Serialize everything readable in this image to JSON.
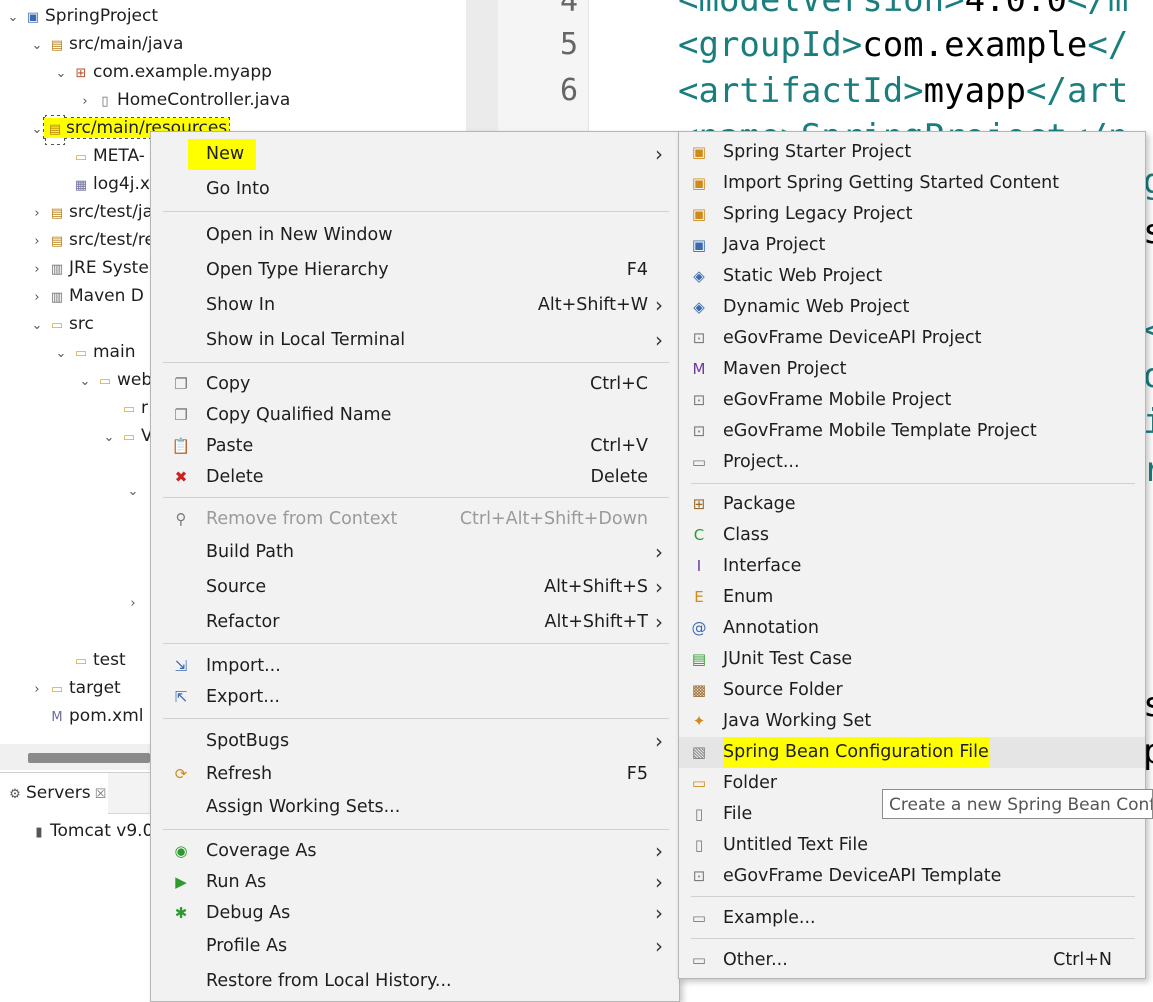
{
  "explorer": {
    "rows": [
      {
        "twisty": "⌄",
        "icon": "▣",
        "label": "SpringProject"
      },
      {
        "twisty": "⌄",
        "icon": "▤",
        "label": "src/main/java"
      },
      {
        "twisty": "⌄",
        "icon": "⊞",
        "label": "com.example.myapp"
      },
      {
        "twisty": "›",
        "icon": "▯",
        "label": "HomeController.java"
      },
      {
        "twisty": "⌄",
        "icon": "▤",
        "label": "src/main/resources"
      },
      {
        "twisty": "",
        "icon": "▭",
        "label": "META-"
      },
      {
        "twisty": "",
        "icon": "▦",
        "label": "log4j.x"
      },
      {
        "twisty": "›",
        "icon": "▤",
        "label": "src/test/ja"
      },
      {
        "twisty": "›",
        "icon": "▤",
        "label": "src/test/re"
      },
      {
        "twisty": "›",
        "icon": "▥",
        "label": "JRE Syste"
      },
      {
        "twisty": "›",
        "icon": "▥",
        "label": "Maven D"
      },
      {
        "twisty": "⌄",
        "icon": "▭",
        "label": "src"
      },
      {
        "twisty": "⌄",
        "icon": "▭",
        "label": "main"
      },
      {
        "twisty": "⌄",
        "icon": "▭",
        "label": "web"
      },
      {
        "twisty": "",
        "icon": "▭",
        "label": "r"
      },
      {
        "twisty": "⌄",
        "icon": "▭",
        "label": "V"
      },
      {
        "twisty": "",
        "icon": "▭",
        "label": "test"
      },
      {
        "twisty": "›",
        "icon": "▭",
        "label": "target"
      },
      {
        "twisty": "",
        "icon": "M",
        "label": "pom.xml"
      }
    ],
    "orphan_twisties": [
      "⌄",
      "›"
    ]
  },
  "servers": {
    "tab_label": "Servers",
    "tab_icon": "⚙",
    "tab_close": "☒",
    "item_icon": "▮",
    "item_label": "Tomcat v9.0"
  },
  "editor": {
    "lines": [
      {
        "num": "4",
        "open": "<modelVersion>",
        "text": "4.0.0",
        "close": "</m"
      },
      {
        "num": "5",
        "open": "<groupId>",
        "text": "com.example",
        "close": "</"
      },
      {
        "num": "6",
        "open": "<artifactId>",
        "text": "myapp",
        "close": "</art"
      }
    ],
    "line7_fragment": "<name>SpringProject</n",
    "right_edge_fragments": [
      "g",
      "s",
      "<",
      "o",
      "i",
      "r",
      "s",
      "p"
    ]
  },
  "context_menu": {
    "items": [
      {
        "icon": "",
        "label": "New",
        "shortcut": "",
        "submenu": true
      },
      {
        "icon": "",
        "label": "Go Into",
        "shortcut": "",
        "submenu": false
      },
      {
        "icon": "",
        "label": "Open in New Window",
        "shortcut": "",
        "submenu": false
      },
      {
        "icon": "",
        "label": "Open Type Hierarchy",
        "shortcut": "F4",
        "submenu": false
      },
      {
        "icon": "",
        "label": "Show In",
        "shortcut": "Alt+Shift+W",
        "submenu": true
      },
      {
        "icon": "",
        "label": "Show in Local Terminal",
        "shortcut": "",
        "submenu": true
      },
      {
        "icon": "❐",
        "label": "Copy",
        "shortcut": "Ctrl+C",
        "submenu": false
      },
      {
        "icon": "❐",
        "label": "Copy Qualified Name",
        "shortcut": "",
        "submenu": false
      },
      {
        "icon": "📋",
        "label": "Paste",
        "shortcut": "Ctrl+V",
        "submenu": false
      },
      {
        "icon": "✖",
        "label": "Delete",
        "shortcut": "Delete",
        "submenu": false
      },
      {
        "icon": "⚲",
        "label": "Remove from Context",
        "shortcut": "Ctrl+Alt+Shift+Down",
        "submenu": false
      },
      {
        "icon": "",
        "label": "Build Path",
        "shortcut": "",
        "submenu": true
      },
      {
        "icon": "",
        "label": "Source",
        "shortcut": "Alt+Shift+S",
        "submenu": true
      },
      {
        "icon": "",
        "label": "Refactor",
        "shortcut": "Alt+Shift+T",
        "submenu": true
      },
      {
        "icon": "⇲",
        "label": "Import...",
        "shortcut": "",
        "submenu": false
      },
      {
        "icon": "⇱",
        "label": "Export...",
        "shortcut": "",
        "submenu": false
      },
      {
        "icon": "",
        "label": "SpotBugs",
        "shortcut": "",
        "submenu": true
      },
      {
        "icon": "⟳",
        "label": "Refresh",
        "shortcut": "F5",
        "submenu": false
      },
      {
        "icon": "",
        "label": "Assign Working Sets...",
        "shortcut": "",
        "submenu": false
      },
      {
        "icon": "◉",
        "label": "Coverage As",
        "shortcut": "",
        "submenu": true
      },
      {
        "icon": "▶",
        "label": "Run As",
        "shortcut": "",
        "submenu": true
      },
      {
        "icon": "✱",
        "label": "Debug As",
        "shortcut": "",
        "submenu": true
      },
      {
        "icon": "",
        "label": "Profile As",
        "shortcut": "",
        "submenu": true
      },
      {
        "icon": "",
        "label": "Restore from Local History...",
        "shortcut": "",
        "submenu": false
      }
    ],
    "submenu_arrow": "›"
  },
  "new_submenu": {
    "items": [
      {
        "icon": "▣",
        "label": "Spring Starter Project",
        "shortcut": ""
      },
      {
        "icon": "▣",
        "label": "Import Spring Getting Started Content",
        "shortcut": ""
      },
      {
        "icon": "▣",
        "label": "Spring Legacy Project",
        "shortcut": ""
      },
      {
        "icon": "▣",
        "label": "Java Project",
        "shortcut": ""
      },
      {
        "icon": "◈",
        "label": "Static Web Project",
        "shortcut": ""
      },
      {
        "icon": "◈",
        "label": "Dynamic Web Project",
        "shortcut": ""
      },
      {
        "icon": "⊡",
        "label": "eGovFrame DeviceAPI Project",
        "shortcut": ""
      },
      {
        "icon": "M",
        "label": "Maven Project",
        "shortcut": ""
      },
      {
        "icon": "⊡",
        "label": "eGovFrame Mobile Project",
        "shortcut": ""
      },
      {
        "icon": "⊡",
        "label": "eGovFrame Mobile Template Project",
        "shortcut": ""
      },
      {
        "icon": "▭",
        "label": "Project...",
        "shortcut": ""
      },
      {
        "icon": "⊞",
        "label": "Package",
        "shortcut": ""
      },
      {
        "icon": "C",
        "label": "Class",
        "shortcut": ""
      },
      {
        "icon": "I",
        "label": "Interface",
        "shortcut": ""
      },
      {
        "icon": "E",
        "label": "Enum",
        "shortcut": ""
      },
      {
        "icon": "@",
        "label": "Annotation",
        "shortcut": ""
      },
      {
        "icon": "▤",
        "label": "JUnit Test Case",
        "shortcut": ""
      },
      {
        "icon": "▩",
        "label": "Source Folder",
        "shortcut": ""
      },
      {
        "icon": "✦",
        "label": "Java Working Set",
        "shortcut": ""
      },
      {
        "icon": "▧",
        "label": "Spring Bean Configuration File",
        "shortcut": ""
      },
      {
        "icon": "▭",
        "label": "Folder",
        "shortcut": ""
      },
      {
        "icon": "▯",
        "label": "File",
        "shortcut": ""
      },
      {
        "icon": "▯",
        "label": "Untitled Text File",
        "shortcut": ""
      },
      {
        "icon": "⊡",
        "label": "eGovFrame DeviceAPI Template",
        "shortcut": ""
      },
      {
        "icon": "▭",
        "label": "Example...",
        "shortcut": ""
      },
      {
        "icon": "▭",
        "label": "Other...",
        "shortcut": "Ctrl+N"
      }
    ]
  },
  "tooltip": {
    "text": "Create a new Spring Bean Confic"
  },
  "colors": {
    "highlight": "#ffff00",
    "xml_tag": "#1b7e7e",
    "menu_bg": "#f2f2f2",
    "selection": "#c9d6f3"
  }
}
